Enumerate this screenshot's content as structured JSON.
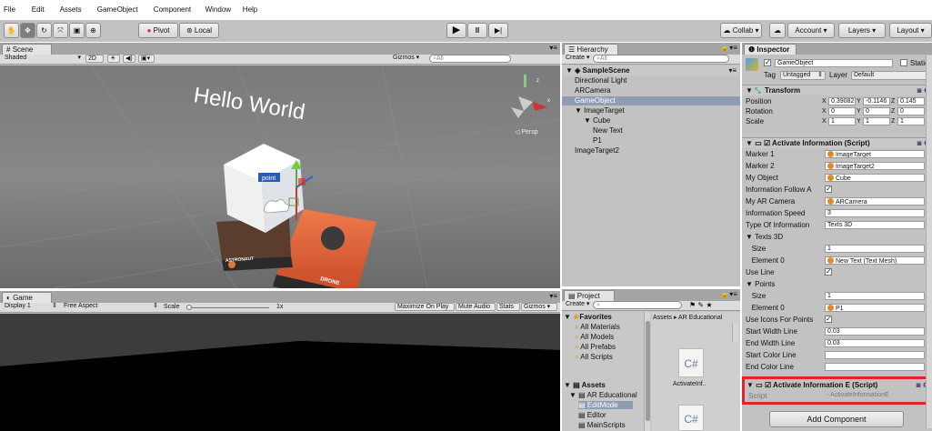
{
  "menu": [
    "File",
    "Edit",
    "Assets",
    "GameObject",
    "Component",
    "Window",
    "Help"
  ],
  "toolbar": {
    "pivot": "Pivot",
    "local": "Local",
    "collab": "Collab ▾",
    "account": "Account",
    "layers": "Layers",
    "layout": "Layout"
  },
  "scene": {
    "tab": "Scene",
    "shaded": "Shaded",
    "mode2d": "2D",
    "gizmos": "Gizmos ▾",
    "search": "All",
    "persp": "◁ Persp",
    "hello": "Hello World",
    "point": "point",
    "card1": "ASTRONAUT",
    "card2": "DRONE"
  },
  "game": {
    "tab": "Game",
    "display": "Display 1",
    "aspect": "Free Aspect",
    "scale": "Scale",
    "scale_value": "1x",
    "maximize": "Maximize On Play",
    "mute": "Mute Audio",
    "stats": "Stats",
    "gizmos": "Gizmos"
  },
  "hierarchy": {
    "tab": "Hierarchy",
    "create": "Create ▾",
    "search": "All",
    "scene": "SampleScene",
    "items": [
      {
        "label": "Directional Light",
        "indent": 1,
        "sel": false
      },
      {
        "label": "ARCamera",
        "indent": 1,
        "sel": false
      },
      {
        "label": "GameObject",
        "indent": 1,
        "sel": true
      },
      {
        "label": "▼ ImageTarget",
        "indent": 1,
        "sel": false
      },
      {
        "label": "▼ Cube",
        "indent": 2,
        "sel": false
      },
      {
        "label": "New Text",
        "indent": 3,
        "sel": false
      },
      {
        "label": "P1",
        "indent": 3,
        "sel": false
      },
      {
        "label": "ImageTarget2",
        "indent": 1,
        "sel": false
      }
    ]
  },
  "project": {
    "tab": "Project",
    "create": "Create ▾",
    "favorites": "Favorites",
    "fav_items": [
      "All Materials",
      "All Models",
      "All Prefabs",
      "All Scripts"
    ],
    "assets": "Assets",
    "asset_items": [
      "AR Educational",
      "EditMode",
      "Editor",
      "MainScripts"
    ],
    "breadcrumb": "Assets ▸ AR Educational",
    "file1": "ActivateInf..",
    "cs": "C#"
  },
  "inspector": {
    "tab": "Inspector",
    "object_name": "GameObject",
    "static": "Static",
    "tag_label": "Tag",
    "tag": "Untagged",
    "layer_label": "Layer",
    "layer": "Default",
    "transform": {
      "title": "Transform",
      "position": {
        "label": "Position",
        "x": "0.39082",
        "y": "-0.1146",
        "z": "0.145"
      },
      "rotation": {
        "label": "Rotation",
        "x": "0",
        "y": "0",
        "z": "0"
      },
      "scale": {
        "label": "Scale",
        "x": "1",
        "y": "1",
        "z": "1"
      }
    },
    "activate": {
      "title": "Activate Information (Script)",
      "rows": [
        {
          "label": "Marker 1",
          "value": "ImageTarget",
          "type": "ref"
        },
        {
          "label": "Marker 2",
          "value": "ImageTarget2",
          "type": "ref"
        },
        {
          "label": "My Object",
          "value": "Cube",
          "type": "ref"
        },
        {
          "label": "Information Follow A",
          "value": "✓",
          "type": "check"
        },
        {
          "label": "My AR Camera",
          "value": "ARCamera",
          "type": "ref"
        },
        {
          "label": "Information Speed",
          "value": "3",
          "type": "text"
        },
        {
          "label": "Type Of Information",
          "value": "Texts 3D",
          "type": "text"
        },
        {
          "label": "▼ Texts 3D",
          "value": "",
          "type": "none"
        },
        {
          "label": "   Size",
          "value": "1",
          "type": "text"
        },
        {
          "label": "   Element 0",
          "value": "New Text (Text Mesh)",
          "type": "ref"
        },
        {
          "label": "Use Line",
          "value": "✓",
          "type": "check"
        },
        {
          "label": "▼ Points",
          "value": "",
          "type": "none"
        },
        {
          "label": "   Size",
          "value": "1",
          "type": "text"
        },
        {
          "label": "   Element 0",
          "value": "P1",
          "type": "ref"
        },
        {
          "label": "Use Icons For Points",
          "value": "✓",
          "type": "check"
        },
        {
          "label": "Start Width Line",
          "value": "0.03",
          "type": "text"
        },
        {
          "label": "End Width Line",
          "value": "0.03",
          "type": "text"
        },
        {
          "label": "Start Color Line",
          "value": "",
          "type": "text"
        },
        {
          "label": "End Color Line",
          "value": "",
          "type": "text"
        }
      ]
    },
    "activate_e": {
      "title": "Activate Information E (Script)",
      "script_label": "Script",
      "script_value": "ActivateInformationE"
    },
    "add_component": "Add Component"
  }
}
